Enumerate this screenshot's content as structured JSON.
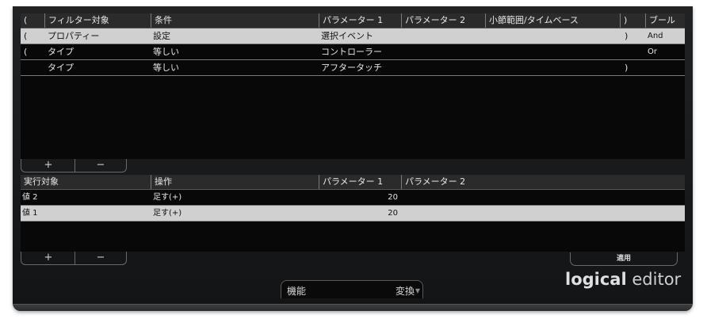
{
  "filter_table": {
    "columns": [
      "(",
      "フィルター対象",
      "条件",
      "パラメーター 1",
      "パラメーター 2",
      "小節範囲/タイムベース",
      ")",
      "ブール"
    ],
    "rows": [
      {
        "open": "(",
        "target": "プロパティー",
        "condition": "設定",
        "param1": "選択イベント",
        "param2": "",
        "range": "",
        "close": ")",
        "bool": "And",
        "selected": true
      },
      {
        "open": "(",
        "target": "タイプ",
        "condition": "等しい",
        "param1": "コントローラー",
        "param2": "",
        "range": "",
        "close": "",
        "bool": "Or",
        "selected": false
      },
      {
        "open": "",
        "target": "タイプ",
        "condition": "等しい",
        "param1": "アフタータッチ",
        "param2": "",
        "range": "",
        "close": ")",
        "bool": "",
        "selected": false
      }
    ],
    "add_label": "+",
    "remove_label": "−"
  },
  "action_table": {
    "columns": [
      "実行対象",
      "操作",
      "パラメーター 1",
      "パラメーター 2"
    ],
    "rows": [
      {
        "target": "値 2",
        "operation": "足す(+)",
        "param1": "20",
        "param2": "",
        "selected": false
      },
      {
        "target": "値 1",
        "operation": "足す(+)",
        "param1": "20",
        "param2": "",
        "selected": true
      }
    ],
    "add_label": "+",
    "remove_label": "−"
  },
  "apply_label": "適用",
  "function": {
    "label": "機能",
    "value": "変換",
    "arrow_icon": "chevron-down-icon"
  },
  "logo": {
    "bold": "logical",
    "light": "editor"
  }
}
